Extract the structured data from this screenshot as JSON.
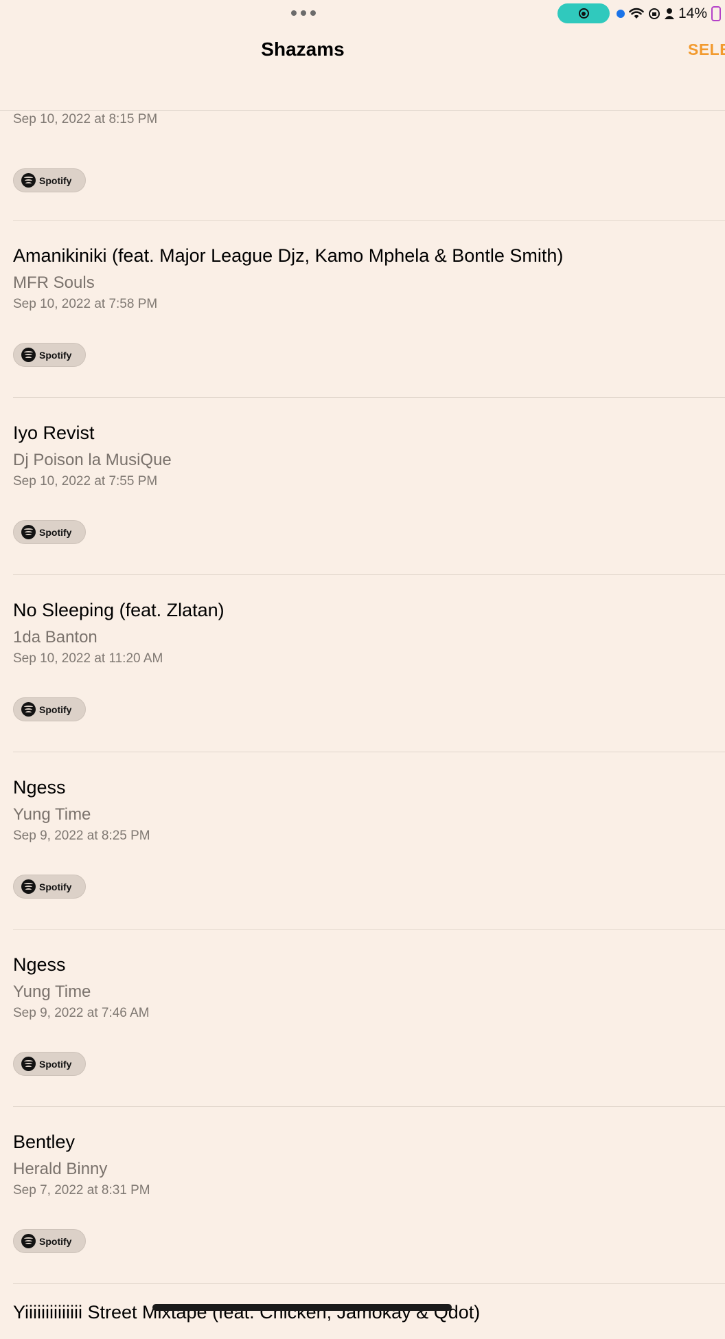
{
  "status_bar": {
    "battery": "14%"
  },
  "nav": {
    "title": "Shazams",
    "select_label": "SELE"
  },
  "spotify_label": "Spotify",
  "items": [
    {
      "title": "",
      "artist": "",
      "date": "Sep 10, 2022 at 8:15 PM"
    },
    {
      "title": "Amanikiniki (feat. Major League Djz, Kamo Mphela & Bontle Smith)",
      "artist": "MFR Souls",
      "date": "Sep 10, 2022 at 7:58 PM"
    },
    {
      "title": "Iyo Revist",
      "artist": "Dj Poison la MusiQue",
      "date": "Sep 10, 2022 at 7:55 PM"
    },
    {
      "title": "No Sleeping (feat. Zlatan)",
      "artist": "1da Banton",
      "date": "Sep 10, 2022 at 11:20 AM"
    },
    {
      "title": "Ngess",
      "artist": "Yung Time",
      "date": "Sep 9, 2022 at 8:25 PM"
    },
    {
      "title": "Ngess",
      "artist": "Yung Time",
      "date": "Sep 9, 2022 at 7:46 AM"
    },
    {
      "title": "Bentley",
      "artist": "Herald Binny",
      "date": "Sep 7, 2022 at 8:31 PM"
    },
    {
      "title": "Yiiiiiiiiiiiiii Street Mixtape (feat. Chicken, Jamokay & Qdot)",
      "artist": "",
      "date": ""
    }
  ]
}
